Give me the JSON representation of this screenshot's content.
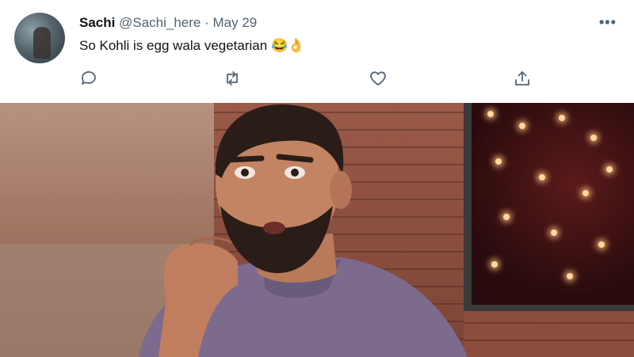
{
  "tweet": {
    "author_name": "Sachi",
    "author_handle": "@Sachi_here",
    "separator": "·",
    "date": "May 29",
    "more_label": "•••",
    "text": "So Kohli is egg wala vegetarian",
    "emojis": [
      "😂",
      "👌"
    ]
  },
  "actions": {
    "icons": [
      "reply-icon",
      "retweet-icon",
      "like-icon",
      "share-icon"
    ]
  },
  "media": {
    "type": "photo"
  },
  "colors": {
    "text_primary": "#0f1419",
    "text_secondary": "#536471"
  }
}
